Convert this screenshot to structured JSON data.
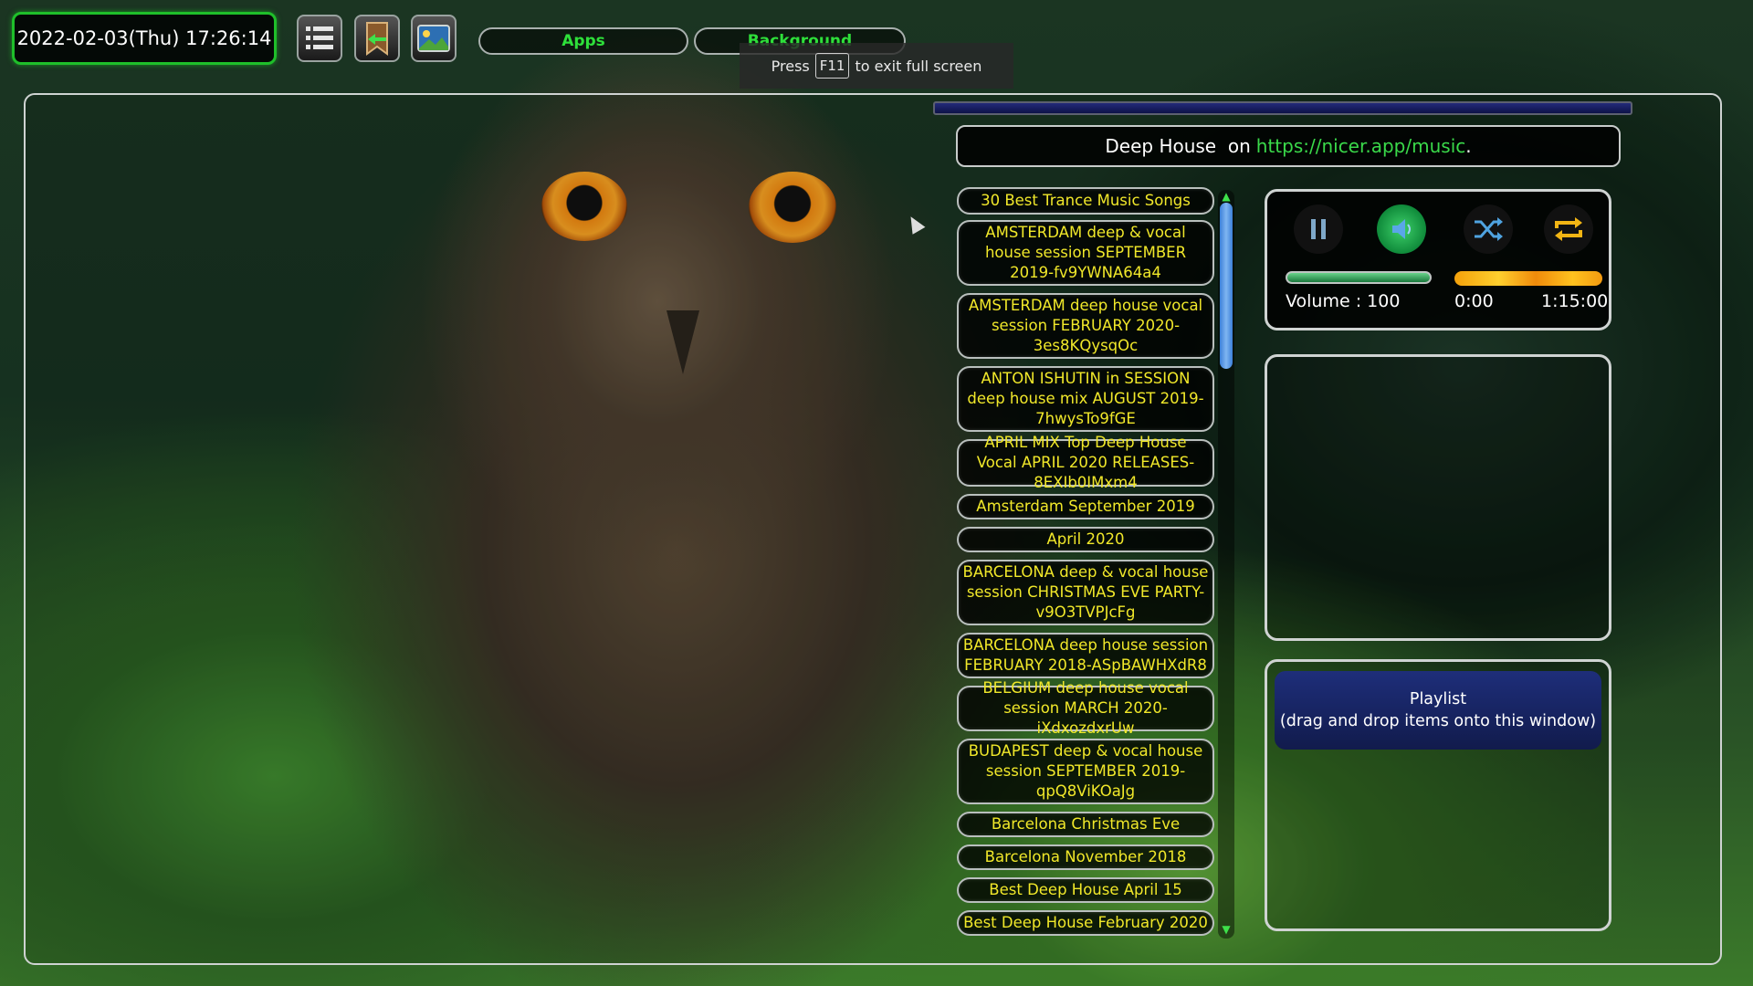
{
  "topbar": {
    "datetime": "2022-02-03(Thu) 17:26:14",
    "buttons": [
      {
        "icon": "list-icon"
      },
      {
        "icon": "back-bookmark-icon"
      },
      {
        "icon": "background-image-icon"
      }
    ],
    "menus": [
      {
        "label": "Apps"
      },
      {
        "label": "Background"
      }
    ]
  },
  "fullscreen_tip": {
    "prefix": "Press",
    "key": "F11",
    "suffix": "to exit full screen"
  },
  "header": {
    "genre": "Deep House",
    "on": "on",
    "url": "https://nicer.app/music",
    "period": "."
  },
  "tracks": [
    "30 Best Trance Music Songs",
    "AMSTERDAM deep & vocal house session SEPTEMBER 2019-fv9YWNA64a4",
    "AMSTERDAM deep house vocal session FEBRUARY 2020-3es8KQysqOc",
    "ANTON ISHUTIN in SESSION deep house mix AUGUST 2019-7hwysTo9fGE",
    "APRIL MIX Top Deep House Vocal APRIL 2020 RELEASES-8EXIb0IMxm4",
    "Amsterdam September 2019",
    "April 2020",
    "BARCELONA deep & vocal house session CHRISTMAS EVE PARTY-v9O3TVPJcFg",
    "BARCELONA deep house session FEBRUARY 2018-ASpBAWHXdR8",
    "BELGIUM deep house vocal session MARCH 2020-iXdxozdxrUw",
    "BUDAPEST deep & vocal house session SEPTEMBER 2019-qpQ8ViKOaJg",
    "Barcelona Christmas Eve",
    "Barcelona November 2018",
    "Best Deep House April 15",
    "Best Deep House February 2020"
  ],
  "player": {
    "volume_label": "Volume : 100",
    "volume": 100,
    "position_time": "0:00",
    "duration_time": "1:15:00",
    "controls": [
      "pause-icon",
      "speaker-icon",
      "shuffle-icon",
      "repeat-icon"
    ],
    "colors": {
      "accent_green": "#1fbf2a",
      "track_text": "#f1e82a",
      "seek_orange": "#f4a10b"
    }
  },
  "playlist": {
    "title": "Playlist",
    "hint": "(drag and drop items onto this window)"
  }
}
